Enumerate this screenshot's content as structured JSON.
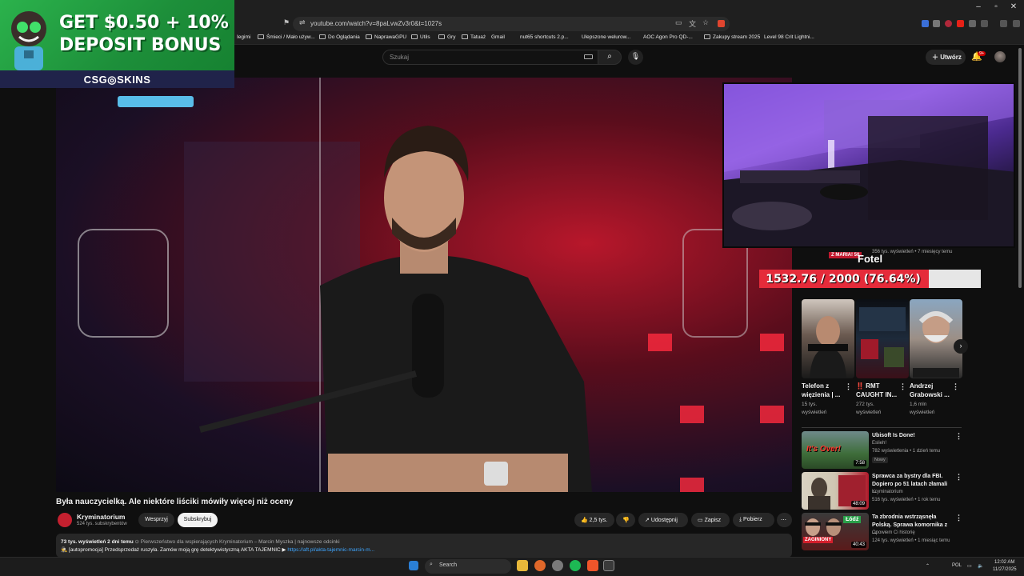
{
  "browser": {
    "url": "youtube.com/watch?v=8paLvwZv3r0&t=1027s",
    "bookmarks": [
      "Iegimi",
      "Śmieci / Mało używ...",
      "Do Oglądania",
      "NaprawaGPU",
      "Utils",
      "Gry",
      "Tatuaż",
      "Gmail",
      "nut65 shortcuts 2.p...",
      "Ulepszone welurow...",
      "AOC Agon Pro QD-...",
      "Zakupy stream 2025",
      "Level 98 Crit Lightni..."
    ]
  },
  "youtube": {
    "search_placeholder": "Szukaj",
    "create_label": "Utwórz",
    "notif_count": "9+"
  },
  "ad": {
    "line1": "GET $0.50 + 10%",
    "line2": "DEPOSIT BONUS",
    "brand": "CSG◎SKINS"
  },
  "video": {
    "title": "Była nauczycielką. Ale niektóre liściki mówiły więcej niż oceny",
    "channel": "Kryminatorium",
    "subscribers": "524 tys. subskrybentów",
    "support_label": "Wesprzyj",
    "subscribe_label": "Subskrybuj",
    "likes": "2,5 tys.",
    "share_label": "Udostępnij",
    "save_label": "Zapisz",
    "download_label": "Pobierz",
    "views_date": "73 tys. wyświetleń  2 dni temu",
    "desc_tags": "⊙ Pierwszeństwo dla wspierających  Kryminatorium – Marcin Myszka | najnowsze odcinki",
    "desc_line2": "🕵 [autopromocja] Przedsprzedaż ruszyła. Zamów moją grę detektywistyczną AKTA TAJEMNIC ▶",
    "desc_link": "https://aft.pl/akta-tajemnic-marcin-m..."
  },
  "donation": {
    "tag": "Z MARIA! 50",
    "title": "Fotel",
    "progress_text": "1532.76 / 2000 (76.64%)",
    "progress_fraction": 0.7664,
    "prev_meta": "356 tys. wyświetleń • 7 miesięcy temu"
  },
  "shorts": [
    {
      "title": "Telefon z więzienia | ...",
      "views": "15 tys.",
      "views2": "wyświetleń"
    },
    {
      "title": "‼️ RMT CAUGHT IN...",
      "views": "272 tys.",
      "views2": "wyświetleń"
    },
    {
      "title": "Andrzej Grabowski ...",
      "views": "1,6 mln",
      "views2": "wyświetleń"
    }
  ],
  "recommended": [
    {
      "title": "Ubisoft Is Done!",
      "channel": "Eslieh!",
      "meta": "782 wyświetlenia • 1 dzień temu",
      "badge": "Nowy",
      "duration": "7:58"
    },
    {
      "title": "Sprawca za bystry dla FBI. Dopiero po 51 latach złamali ...",
      "channel": "Kryminatorium",
      "meta": "516 tys. wyświetleń • 1 rok temu",
      "badge": "",
      "duration": "48:09"
    },
    {
      "title": "Ta zbrodnia wstrząsnęła Polską. Sprawa komornika z ...",
      "channel": "Opowiem Ci historię",
      "meta": "124 tys. wyświetleń • 1 miesiąc temu",
      "badge": "",
      "duration": "40:43"
    }
  ],
  "thumb_text": {
    "ubisoft": "It's Over!",
    "zaginiony": "ZAGINIONY",
    "lodz": "Łódź"
  },
  "taskbar": {
    "search_label": "Search",
    "lang": "POL",
    "time": "12:02 AM",
    "date": "11/27/2025"
  }
}
